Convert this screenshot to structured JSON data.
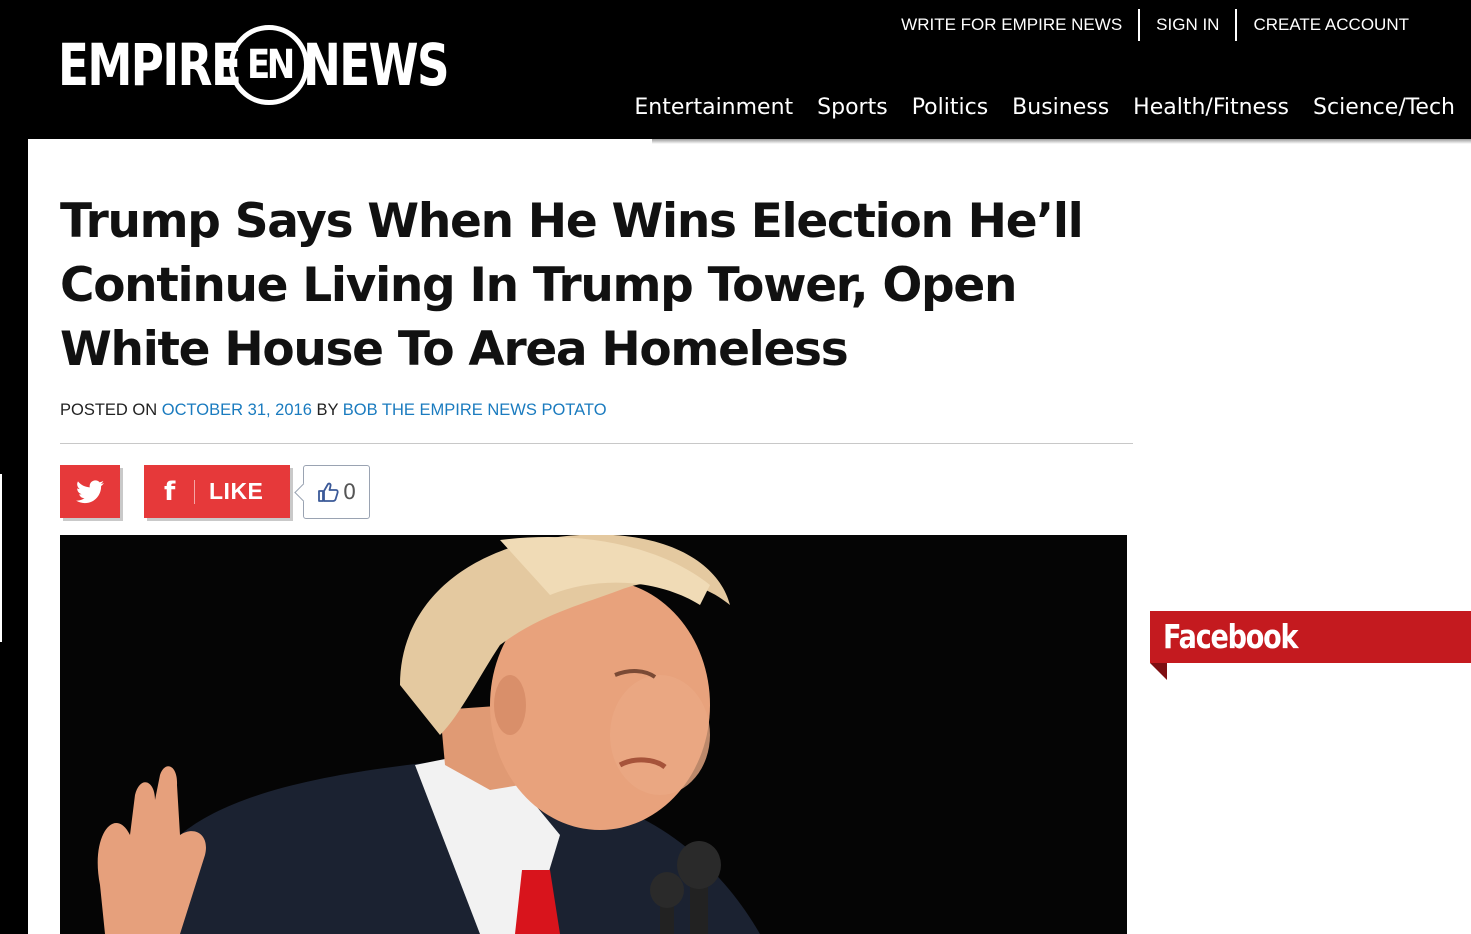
{
  "site": {
    "logo_left": "EMPIRE",
    "logo_badge": "EN",
    "logo_right": "NEWS"
  },
  "top_links": [
    "WRITE FOR EMPIRE NEWS",
    "SIGN IN",
    "CREATE ACCOUNT"
  ],
  "main_nav": [
    "Entertainment",
    "Sports",
    "Politics",
    "Business",
    "Health/Fitness",
    "Science/Tech"
  ],
  "article": {
    "title": "Trump Says When He Wins Election He’ll Continue Living In Trump Tower, Open White House To Area Homeless",
    "posted_on_label": "POSTED ON",
    "date": "OCTOBER 31, 2016",
    "by_label": "BY",
    "author": "BOB THE EMPIRE NEWS POTATO"
  },
  "share": {
    "facebook_glyph": "f",
    "like_label": "LIKE",
    "like_count": "0"
  },
  "sidebar": {
    "facebook_title": "Facebook"
  },
  "colors": {
    "link_blue": "#1a7bbf",
    "share_red": "#e6393a",
    "widget_red": "#c41a1f",
    "tie_red": "#d8141c"
  },
  "icons": [
    "twitter-bird-icon",
    "facebook-f-icon",
    "thumbs-up-icon"
  ]
}
